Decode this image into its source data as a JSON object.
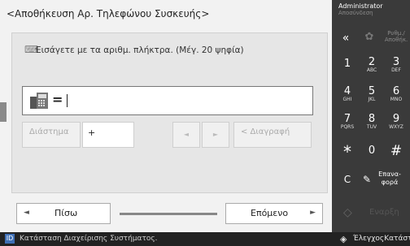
{
  "header": {
    "title": "<Αποθήκευση Αρ. Τηλεφώνου Συσκευής>"
  },
  "instruction": {
    "text": "Εισάγετε με τα αριθμ. πλήκτρα. (Μέγ. 20 ψηφία)"
  },
  "input": {
    "value": "="
  },
  "edit_keys": {
    "space": "Διάστημα",
    "plus": "+",
    "left_arrow": "◄",
    "right_arrow": "►",
    "delete": "< Διαγραφή"
  },
  "nav": {
    "back_label": "Πίσω",
    "next_label": "Επόμενο",
    "back_arrow": "◄",
    "next_arrow": "►"
  },
  "keypad": {
    "user": "Administrator",
    "logout": "Αποσύνδεση",
    "back_symbol": "«",
    "settings_label": "Ρυθμ./ Αποθήκ.",
    "keys": [
      {
        "d": "1",
        "l": ""
      },
      {
        "d": "2",
        "l": "ABC"
      },
      {
        "d": "3",
        "l": "DEF"
      },
      {
        "d": "4",
        "l": "GHI"
      },
      {
        "d": "5",
        "l": "JKL"
      },
      {
        "d": "6",
        "l": "MNO"
      },
      {
        "d": "7",
        "l": "PQRS"
      },
      {
        "d": "8",
        "l": "TUV"
      },
      {
        "d": "9",
        "l": "WXYZ"
      }
    ],
    "star": "*",
    "zero": "0",
    "hash": "#",
    "clear": "C",
    "reset_label": "Επανα- φορά",
    "start_label": "Εναρξη"
  },
  "status": {
    "left_text": "Κατάσταση Διαχείρισης Συστήματος.",
    "right_text": "ΈλεγχοςΚατάστ"
  },
  "colors": {
    "status_icon": "#3f6fb5",
    "panel_dark": "#3a3a3a"
  }
}
